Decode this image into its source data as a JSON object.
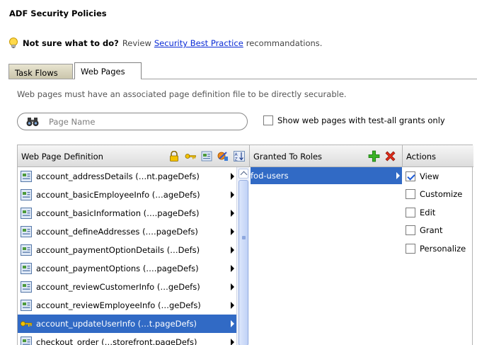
{
  "page": {
    "title": "ADF Security Policies"
  },
  "hint": {
    "question": "Not sure what to do?",
    "pre_text": "Review",
    "link_text": "Security Best Practice",
    "post_text": "recommandations."
  },
  "tabs": [
    {
      "label": "Task Flows",
      "selected": false
    },
    {
      "label": "Web Pages",
      "selected": true
    }
  ],
  "description": "Web pages must have an associated page definition file to be directly securable.",
  "search": {
    "placeholder": "Page Name",
    "icon": "binoculars-icon"
  },
  "show_test_all": {
    "label": "Show web pages with test-all grants only",
    "checked": false
  },
  "grid": {
    "pages_header": "Web Page Definition",
    "roles_header": "Granted To Roles",
    "actions_header": "Actions",
    "header_icons": [
      "lock-icon",
      "key-icon",
      "page-icon",
      "grant-icon",
      "sort-icon"
    ],
    "role_icons": [
      "add-icon",
      "delete-icon"
    ]
  },
  "pages": [
    {
      "label": "account_addressDetails (…nt.pageDefs)",
      "selected": false,
      "icon": "page-def-icon"
    },
    {
      "label": "account_basicEmployeeInfo (…ageDefs)",
      "selected": false,
      "icon": "page-def-icon"
    },
    {
      "label": "account_basicInformation (….pageDefs)",
      "selected": false,
      "icon": "page-def-icon"
    },
    {
      "label": "account_defineAddresses (….pageDefs)",
      "selected": false,
      "icon": "page-def-icon"
    },
    {
      "label": "account_paymentOptionDetails (…Defs)",
      "selected": false,
      "icon": "page-def-icon"
    },
    {
      "label": "account_paymentOptions (….pageDefs)",
      "selected": false,
      "icon": "page-def-icon"
    },
    {
      "label": "account_reviewCustomerInfo (…geDefs)",
      "selected": false,
      "icon": "page-def-icon"
    },
    {
      "label": "account_reviewEmployeeInfo (…geDefs)",
      "selected": false,
      "icon": "page-def-icon"
    },
    {
      "label": "account_updateUserInfo (…t.pageDefs)",
      "selected": true,
      "icon": "key-icon"
    },
    {
      "label": "checkout_order (…storefront.pageDefs)",
      "selected": false,
      "icon": "page-def-icon"
    }
  ],
  "roles": [
    {
      "label": "fod-users",
      "selected": true
    }
  ],
  "actions": [
    {
      "label": "View",
      "checked": true
    },
    {
      "label": "Customize",
      "checked": false
    },
    {
      "label": "Edit",
      "checked": false
    },
    {
      "label": "Grant",
      "checked": false
    },
    {
      "label": "Personalize",
      "checked": false
    }
  ],
  "colors": {
    "selection": "#316ac5",
    "link": "#0a2bd6"
  }
}
